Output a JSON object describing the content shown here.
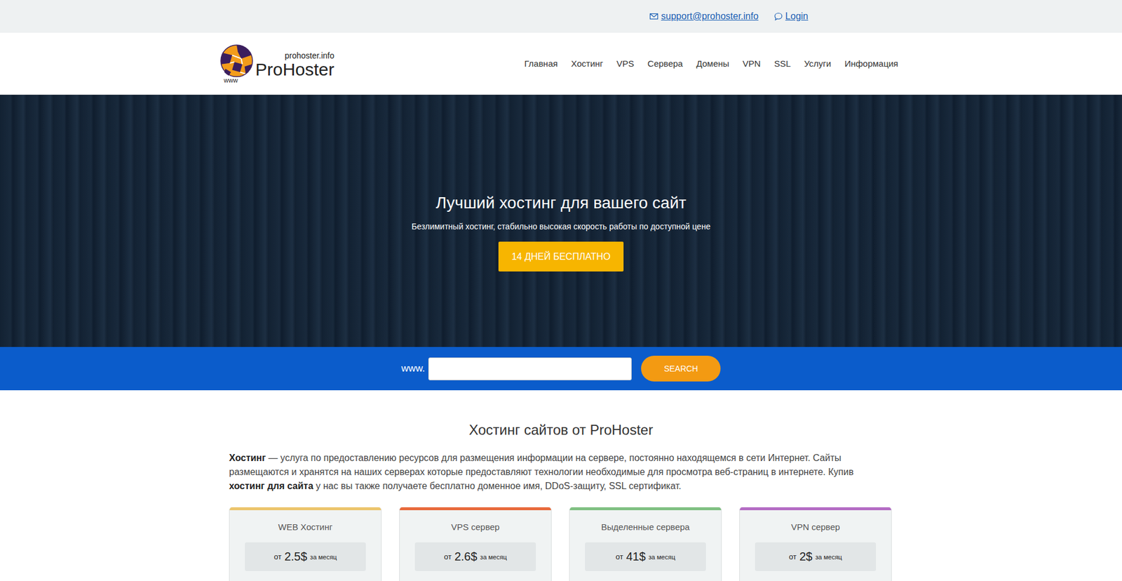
{
  "topbar": {
    "email": "support@prohoster.info",
    "login": "Login"
  },
  "logo": {
    "domain": "prohoster.info",
    "name": "ProHoster",
    "www": "www"
  },
  "nav": [
    {
      "label": "Главная"
    },
    {
      "label": "Хостинг"
    },
    {
      "label": "VPS"
    },
    {
      "label": "Сервера"
    },
    {
      "label": "Домены"
    },
    {
      "label": "VPN"
    },
    {
      "label": "SSL"
    },
    {
      "label": "Услуги"
    },
    {
      "label": "Информация"
    }
  ],
  "hero": {
    "title": "Лучший хостинг для вашего сайт",
    "subtitle": "Безлимитный хостинг, стабильно высокая скорость работы по доступной цене",
    "button": "14 ДНЕЙ БЕСПЛАТНО"
  },
  "search": {
    "prefix": "www.",
    "value": "",
    "button": "SEARCH"
  },
  "intro": {
    "title": "Хостинг сайтов от ProHoster",
    "paragraph": [
      {
        "text": "Хостинг",
        "bold": true
      },
      {
        "text": " — услуга по предоставлению ресурсов для размещения информации на сервере, постоянно находящемся в сети Интернет. Сайты размещаются и хранятся на наших серверах которые предоставляют технологии необходимые для просмотра веб-страниц в интернете. Купив ",
        "bold": false
      },
      {
        "text": "хостинг для сайта",
        "bold": true
      },
      {
        "text": " у нас вы также получаете бесплатно доменное имя, DDoS-защиту, SSL сертификат.",
        "bold": false
      }
    ]
  },
  "plans": [
    {
      "name": "WEB Хостинг",
      "from": "от",
      "price": "2.5$",
      "period": "за месяц",
      "color": "#ecc56c"
    },
    {
      "name": "VPS сервер",
      "from": "от",
      "price": "2.6$",
      "period": "за месяц",
      "color": "#e86a3c"
    },
    {
      "name": "Выделенные сервера",
      "from": "от",
      "price": "41$",
      "period": "за месяц",
      "color": "#80c082"
    },
    {
      "name": "VPN сервер",
      "from": "от",
      "price": "2$",
      "period": "за месяц",
      "color": "#b46cc4"
    }
  ]
}
